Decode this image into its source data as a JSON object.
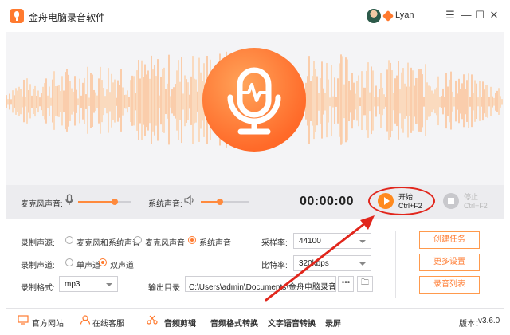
{
  "window": {
    "title": "金舟电脑录音软件",
    "user_name": "Lyan"
  },
  "window_controls": {
    "menu": "☰",
    "minimize": "—",
    "maximize": "☐",
    "close": "✕"
  },
  "controls": {
    "mic_label": "麦克风声音:",
    "mic_level": 0.7,
    "system_label": "系统声音:",
    "system_level": 0.4,
    "timer": "00:00:00",
    "start_label": "开始",
    "start_shortcut": "Ctrl+F2",
    "stop_label": "停止",
    "stop_shortcut": "Ctrl+F2"
  },
  "settings": {
    "source_label": "录制声源:",
    "source_options": [
      "麦克风和系统声音",
      "麦克风声音",
      "系统声音"
    ],
    "source_selected": 2,
    "channel_label": "录制声道:",
    "channel_options": [
      "单声道",
      "双声道"
    ],
    "channel_selected": 1,
    "format_label": "录制格式:",
    "format_value": "mp3",
    "sample_rate_label": "采样率:",
    "sample_rate_value": "44100",
    "bitrate_label": "比特率:",
    "bitrate_value": "320kbps",
    "output_label": "输出目录",
    "output_path": "C:\\Users\\admin\\Documents\\金舟电脑录音软",
    "more_button": "•••",
    "folder_button": "🗀"
  },
  "side_buttons": {
    "create_task": "创建任务",
    "more_settings": "更多设置",
    "record_list": "录音列表"
  },
  "footer": {
    "website": "官方网站",
    "online_service": "在线客服",
    "audio_cut": "音频剪辑",
    "format_convert": "音频格式转换",
    "tts": "文字语音转换",
    "screen_record": "录屏",
    "version_label": "版本：",
    "version_value": "v3.6.0"
  },
  "colors": {
    "accent": "#ff7a2f",
    "highlight_ring": "#e1261c"
  }
}
